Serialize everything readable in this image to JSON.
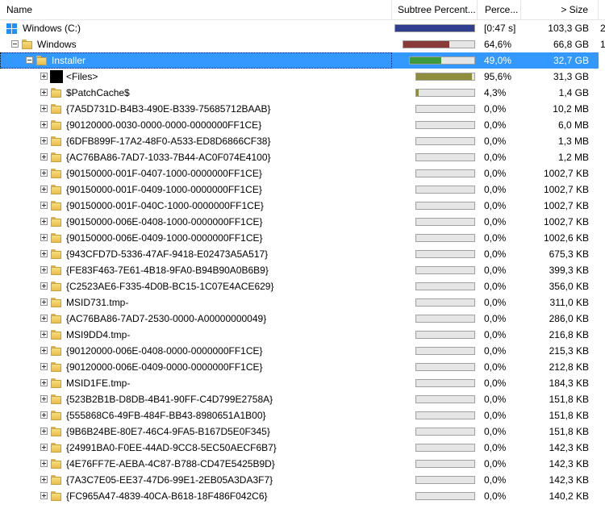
{
  "header": {
    "name": "Name",
    "subtree_percent": "Subtree Percent...",
    "percent": "Perce...",
    "size": "> Size"
  },
  "rows": [
    {
      "level": 0,
      "icon": "drive-icon",
      "expander": "none",
      "name": "Windows (C:)",
      "bar": {
        "fraction": 1.0,
        "color": "#2f3e8e",
        "track": 100
      },
      "percent": "[0:47 s]",
      "size": "103,3 GB",
      "extra": "2"
    },
    {
      "level": 1,
      "icon": "folder-icon",
      "expander": "minus",
      "name": "Windows",
      "bar": {
        "fraction": 0.646,
        "color": "#8b3a3a",
        "track": 90
      },
      "percent": "64,6%",
      "size": "66,8 GB",
      "extra": "1"
    },
    {
      "level": 2,
      "icon": "folder-icon",
      "expander": "minus",
      "name": "Installer",
      "selected": true,
      "bar": {
        "fraction": 0.49,
        "color": "#3c9a3c",
        "track": 82
      },
      "percent": "49,0%",
      "size": "32,7 GB",
      "extra": ""
    },
    {
      "level": 3,
      "icon": "black-icon",
      "expander": "plus",
      "name": "<Files>",
      "bar": {
        "fraction": 0.956,
        "color": "#8e8e3c",
        "track": 74
      },
      "percent": "95,6%",
      "size": "31,3 GB",
      "extra": ""
    },
    {
      "level": 3,
      "icon": "folder-icon",
      "expander": "plus",
      "name": "$PatchCache$",
      "bar": {
        "fraction": 0.043,
        "color": "#8e8e3c",
        "track": 74
      },
      "percent": "4,3%",
      "size": "1,4 GB",
      "extra": ""
    },
    {
      "level": 3,
      "icon": "folder-icon",
      "expander": "plus",
      "name": "{7A5D731D-B4B3-490E-B339-75685712BAAB}",
      "bar": {
        "fraction": 0.0,
        "color": "#8e8e3c",
        "track": 74
      },
      "percent": "0,0%",
      "size": "10,2 MB",
      "extra": ""
    },
    {
      "level": 3,
      "icon": "folder-icon",
      "expander": "plus",
      "name": "{90120000-0030-0000-0000-0000000FF1CE}",
      "bar": {
        "fraction": 0.0,
        "color": "#8e8e3c",
        "track": 74
      },
      "percent": "0,0%",
      "size": "6,0 MB",
      "extra": ""
    },
    {
      "level": 3,
      "icon": "folder-icon",
      "expander": "plus",
      "name": "{6DFB899F-17A2-48F0-A533-ED8D6866CF38}",
      "bar": {
        "fraction": 0.0,
        "color": "#8e8e3c",
        "track": 74
      },
      "percent": "0,0%",
      "size": "1,3 MB",
      "extra": ""
    },
    {
      "level": 3,
      "icon": "folder-icon",
      "expander": "plus",
      "name": "{AC76BA86-7AD7-1033-7B44-AC0F074E4100}",
      "bar": {
        "fraction": 0.0,
        "color": "#8e8e3c",
        "track": 74
      },
      "percent": "0,0%",
      "size": "1,2 MB",
      "extra": ""
    },
    {
      "level": 3,
      "icon": "folder-icon",
      "expander": "plus",
      "name": "{90150000-001F-0407-1000-0000000FF1CE}",
      "bar": {
        "fraction": 0.0,
        "color": "#8e8e3c",
        "track": 74
      },
      "percent": "0,0%",
      "size": "1002,7 KB",
      "extra": ""
    },
    {
      "level": 3,
      "icon": "folder-icon",
      "expander": "plus",
      "name": "{90150000-001F-0409-1000-0000000FF1CE}",
      "bar": {
        "fraction": 0.0,
        "color": "#8e8e3c",
        "track": 74
      },
      "percent": "0,0%",
      "size": "1002,7 KB",
      "extra": ""
    },
    {
      "level": 3,
      "icon": "folder-icon",
      "expander": "plus",
      "name": "{90150000-001F-040C-1000-0000000FF1CE}",
      "bar": {
        "fraction": 0.0,
        "color": "#8e8e3c",
        "track": 74
      },
      "percent": "0,0%",
      "size": "1002,7 KB",
      "extra": ""
    },
    {
      "level": 3,
      "icon": "folder-icon",
      "expander": "plus",
      "name": "{90150000-006E-0408-1000-0000000FF1CE}",
      "bar": {
        "fraction": 0.0,
        "color": "#8e8e3c",
        "track": 74
      },
      "percent": "0,0%",
      "size": "1002,7 KB",
      "extra": ""
    },
    {
      "level": 3,
      "icon": "folder-icon",
      "expander": "plus",
      "name": "{90150000-006E-0409-1000-0000000FF1CE}",
      "bar": {
        "fraction": 0.0,
        "color": "#8e8e3c",
        "track": 74
      },
      "percent": "0,0%",
      "size": "1002,6 KB",
      "extra": ""
    },
    {
      "level": 3,
      "icon": "folder-icon",
      "expander": "plus",
      "name": "{943CFD7D-5336-47AF-9418-E02473A5A517}",
      "bar": {
        "fraction": 0.0,
        "color": "#8e8e3c",
        "track": 74
      },
      "percent": "0,0%",
      "size": "675,3 KB",
      "extra": ""
    },
    {
      "level": 3,
      "icon": "folder-icon",
      "expander": "plus",
      "name": "{FE83F463-7E61-4B18-9FA0-B94B90A0B6B9}",
      "bar": {
        "fraction": 0.0,
        "color": "#8e8e3c",
        "track": 74
      },
      "percent": "0,0%",
      "size": "399,3 KB",
      "extra": ""
    },
    {
      "level": 3,
      "icon": "folder-icon",
      "expander": "plus",
      "name": "{C2523AE6-F335-4D0B-BC15-1C07E4ACE629}",
      "bar": {
        "fraction": 0.0,
        "color": "#8e8e3c",
        "track": 74
      },
      "percent": "0,0%",
      "size": "356,0 KB",
      "extra": ""
    },
    {
      "level": 3,
      "icon": "folder-icon",
      "expander": "plus",
      "name": "MSID731.tmp-",
      "bar": {
        "fraction": 0.0,
        "color": "#8e8e3c",
        "track": 74
      },
      "percent": "0,0%",
      "size": "311,0 KB",
      "extra": ""
    },
    {
      "level": 3,
      "icon": "folder-icon",
      "expander": "plus",
      "name": "{AC76BA86-7AD7-2530-0000-A00000000049}",
      "bar": {
        "fraction": 0.0,
        "color": "#8e8e3c",
        "track": 74
      },
      "percent": "0,0%",
      "size": "286,0 KB",
      "extra": ""
    },
    {
      "level": 3,
      "icon": "folder-icon",
      "expander": "plus",
      "name": "MSI9DD4.tmp-",
      "bar": {
        "fraction": 0.0,
        "color": "#8e8e3c",
        "track": 74
      },
      "percent": "0,0%",
      "size": "216,8 KB",
      "extra": ""
    },
    {
      "level": 3,
      "icon": "folder-icon",
      "expander": "plus",
      "name": "{90120000-006E-0408-0000-0000000FF1CE}",
      "bar": {
        "fraction": 0.0,
        "color": "#8e8e3c",
        "track": 74
      },
      "percent": "0,0%",
      "size": "215,3 KB",
      "extra": ""
    },
    {
      "level": 3,
      "icon": "folder-icon",
      "expander": "plus",
      "name": "{90120000-006E-0409-0000-0000000FF1CE}",
      "bar": {
        "fraction": 0.0,
        "color": "#8e8e3c",
        "track": 74
      },
      "percent": "0,0%",
      "size": "212,8 KB",
      "extra": ""
    },
    {
      "level": 3,
      "icon": "folder-icon",
      "expander": "plus",
      "name": "MSID1FE.tmp-",
      "bar": {
        "fraction": 0.0,
        "color": "#8e8e3c",
        "track": 74
      },
      "percent": "0,0%",
      "size": "184,3 KB",
      "extra": ""
    },
    {
      "level": 3,
      "icon": "folder-icon",
      "expander": "plus",
      "name": "{523B2B1B-D8DB-4B41-90FF-C4D799E2758A}",
      "bar": {
        "fraction": 0.0,
        "color": "#8e8e3c",
        "track": 74
      },
      "percent": "0,0%",
      "size": "151,8 KB",
      "extra": ""
    },
    {
      "level": 3,
      "icon": "folder-icon",
      "expander": "plus",
      "name": "{555868C6-49FB-484F-BB43-8980651A1B00}",
      "bar": {
        "fraction": 0.0,
        "color": "#8e8e3c",
        "track": 74
      },
      "percent": "0,0%",
      "size": "151,8 KB",
      "extra": ""
    },
    {
      "level": 3,
      "icon": "folder-icon",
      "expander": "plus",
      "name": "{9B6B24BE-80E7-46C4-9FA5-B167D5E0F345}",
      "bar": {
        "fraction": 0.0,
        "color": "#8e8e3c",
        "track": 74
      },
      "percent": "0,0%",
      "size": "151,8 KB",
      "extra": ""
    },
    {
      "level": 3,
      "icon": "folder-icon",
      "expander": "plus",
      "name": "{24991BA0-F0EE-44AD-9CC8-5EC50AECF6B7}",
      "bar": {
        "fraction": 0.0,
        "color": "#8e8e3c",
        "track": 74
      },
      "percent": "0,0%",
      "size": "142,3 KB",
      "extra": ""
    },
    {
      "level": 3,
      "icon": "folder-icon",
      "expander": "plus",
      "name": "{4E76FF7E-AEBA-4C87-B788-CD47E5425B9D}",
      "bar": {
        "fraction": 0.0,
        "color": "#8e8e3c",
        "track": 74
      },
      "percent": "0,0%",
      "size": "142,3 KB",
      "extra": ""
    },
    {
      "level": 3,
      "icon": "folder-icon",
      "expander": "plus",
      "name": "{7A3C7E05-EE37-47D6-99E1-2EB05A3DA3F7}",
      "bar": {
        "fraction": 0.0,
        "color": "#8e8e3c",
        "track": 74
      },
      "percent": "0,0%",
      "size": "142,3 KB",
      "extra": ""
    },
    {
      "level": 3,
      "icon": "folder-icon",
      "expander": "plus",
      "name": "{FC965A47-4839-40CA-B618-18F486F042C6}",
      "bar": {
        "fraction": 0.0,
        "color": "#8e8e3c",
        "track": 74
      },
      "percent": "0,0%",
      "size": "140,2 KB",
      "extra": ""
    }
  ]
}
